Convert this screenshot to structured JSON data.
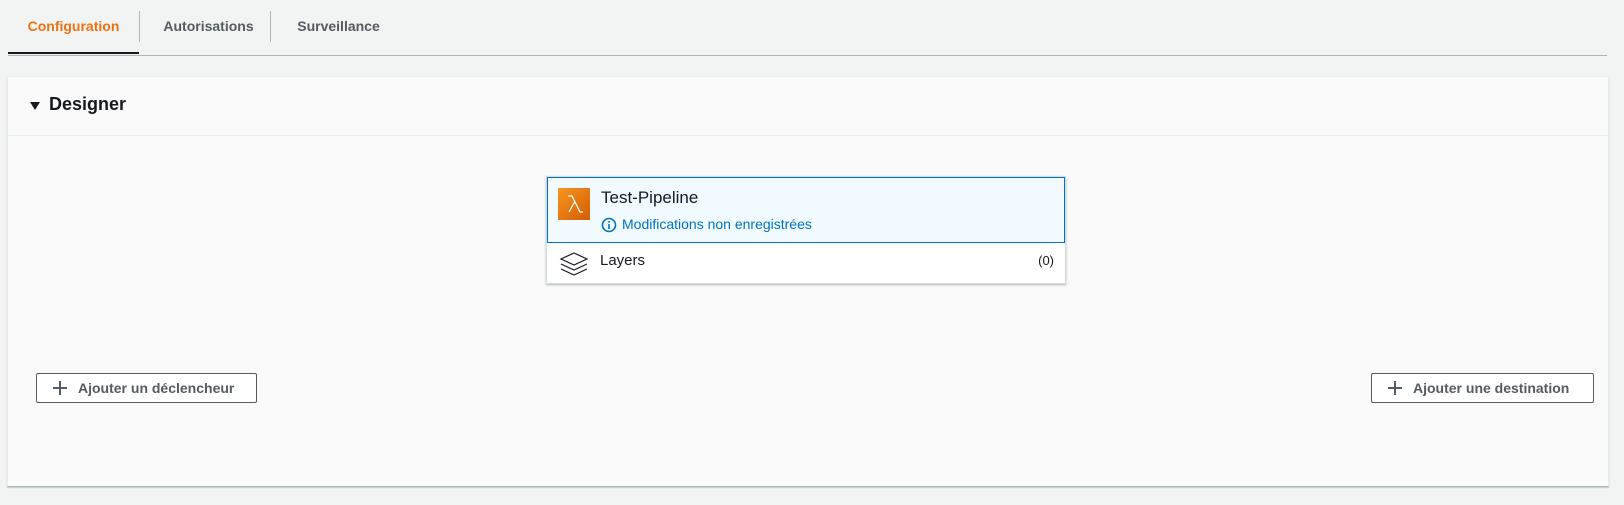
{
  "tabs": [
    {
      "label": "Configuration",
      "active": true
    },
    {
      "label": "Autorisations",
      "active": false
    },
    {
      "label": "Surveillance",
      "active": false
    }
  ],
  "designer": {
    "title": "Designer",
    "expanded": true
  },
  "function": {
    "name": "Test-Pipeline",
    "status": "Modifications non enregistrées",
    "icon": "lambda-icon"
  },
  "layers": {
    "label": "Layers",
    "count": "(0)"
  },
  "actions": {
    "add_trigger": "Ajouter un déclencheur",
    "add_destination": "Ajouter une destination"
  },
  "colors": {
    "accent": "#ec7211",
    "link": "#0073bb"
  }
}
